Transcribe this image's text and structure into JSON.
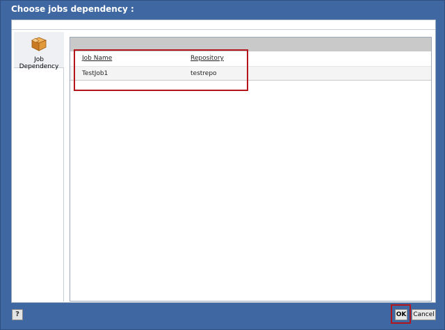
{
  "dialog": {
    "title": "Choose jobs dependency :"
  },
  "sidebar": {
    "items": [
      {
        "label": "Job Dependency",
        "icon": "package-box-icon"
      }
    ]
  },
  "grid": {
    "columns": [
      "Job Name",
      "Repository"
    ],
    "rows": [
      [
        "TestJob1",
        "testrepo"
      ]
    ]
  },
  "footer": {
    "help_label": "?",
    "ok_label": "OK",
    "cancel_label": "Cancel"
  },
  "colors": {
    "frame": "#3f67a2",
    "highlight": "#b3151b",
    "header_bar": "#c9c9c9"
  }
}
